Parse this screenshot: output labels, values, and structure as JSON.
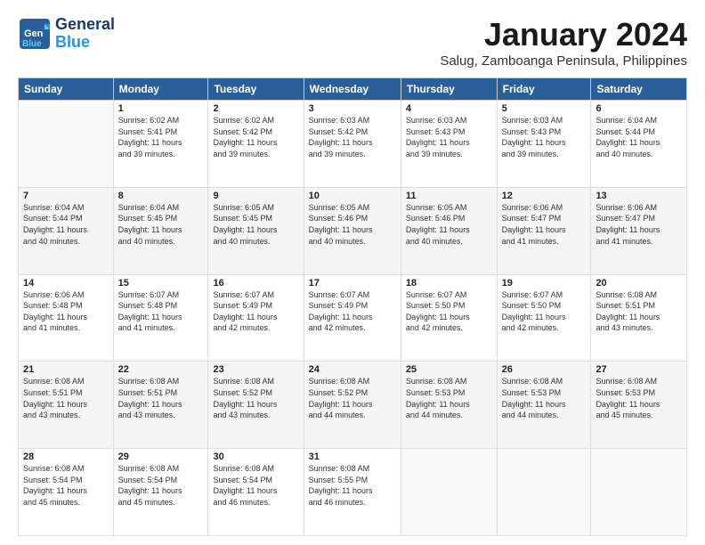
{
  "header": {
    "logo_line1": "General",
    "logo_line2": "Blue",
    "month": "January 2024",
    "location": "Salug, Zamboanga Peninsula, Philippines"
  },
  "weekdays": [
    "Sunday",
    "Monday",
    "Tuesday",
    "Wednesday",
    "Thursday",
    "Friday",
    "Saturday"
  ],
  "weeks": [
    [
      {
        "day": "",
        "lines": []
      },
      {
        "day": "1",
        "lines": [
          "Sunrise: 6:02 AM",
          "Sunset: 5:41 PM",
          "Daylight: 11 hours",
          "and 39 minutes."
        ]
      },
      {
        "day": "2",
        "lines": [
          "Sunrise: 6:02 AM",
          "Sunset: 5:42 PM",
          "Daylight: 11 hours",
          "and 39 minutes."
        ]
      },
      {
        "day": "3",
        "lines": [
          "Sunrise: 6:03 AM",
          "Sunset: 5:42 PM",
          "Daylight: 11 hours",
          "and 39 minutes."
        ]
      },
      {
        "day": "4",
        "lines": [
          "Sunrise: 6:03 AM",
          "Sunset: 5:43 PM",
          "Daylight: 11 hours",
          "and 39 minutes."
        ]
      },
      {
        "day": "5",
        "lines": [
          "Sunrise: 6:03 AM",
          "Sunset: 5:43 PM",
          "Daylight: 11 hours",
          "and 39 minutes."
        ]
      },
      {
        "day": "6",
        "lines": [
          "Sunrise: 6:04 AM",
          "Sunset: 5:44 PM",
          "Daylight: 11 hours",
          "and 40 minutes."
        ]
      }
    ],
    [
      {
        "day": "7",
        "lines": [
          "Sunrise: 6:04 AM",
          "Sunset: 5:44 PM",
          "Daylight: 11 hours",
          "and 40 minutes."
        ]
      },
      {
        "day": "8",
        "lines": [
          "Sunrise: 6:04 AM",
          "Sunset: 5:45 PM",
          "Daylight: 11 hours",
          "and 40 minutes."
        ]
      },
      {
        "day": "9",
        "lines": [
          "Sunrise: 6:05 AM",
          "Sunset: 5:45 PM",
          "Daylight: 11 hours",
          "and 40 minutes."
        ]
      },
      {
        "day": "10",
        "lines": [
          "Sunrise: 6:05 AM",
          "Sunset: 5:46 PM",
          "Daylight: 11 hours",
          "and 40 minutes."
        ]
      },
      {
        "day": "11",
        "lines": [
          "Sunrise: 6:05 AM",
          "Sunset: 5:46 PM",
          "Daylight: 11 hours",
          "and 40 minutes."
        ]
      },
      {
        "day": "12",
        "lines": [
          "Sunrise: 6:06 AM",
          "Sunset: 5:47 PM",
          "Daylight: 11 hours",
          "and 41 minutes."
        ]
      },
      {
        "day": "13",
        "lines": [
          "Sunrise: 6:06 AM",
          "Sunset: 5:47 PM",
          "Daylight: 11 hours",
          "and 41 minutes."
        ]
      }
    ],
    [
      {
        "day": "14",
        "lines": [
          "Sunrise: 6:06 AM",
          "Sunset: 5:48 PM",
          "Daylight: 11 hours",
          "and 41 minutes."
        ]
      },
      {
        "day": "15",
        "lines": [
          "Sunrise: 6:07 AM",
          "Sunset: 5:48 PM",
          "Daylight: 11 hours",
          "and 41 minutes."
        ]
      },
      {
        "day": "16",
        "lines": [
          "Sunrise: 6:07 AM",
          "Sunset: 5:49 PM",
          "Daylight: 11 hours",
          "and 42 minutes."
        ]
      },
      {
        "day": "17",
        "lines": [
          "Sunrise: 6:07 AM",
          "Sunset: 5:49 PM",
          "Daylight: 11 hours",
          "and 42 minutes."
        ]
      },
      {
        "day": "18",
        "lines": [
          "Sunrise: 6:07 AM",
          "Sunset: 5:50 PM",
          "Daylight: 11 hours",
          "and 42 minutes."
        ]
      },
      {
        "day": "19",
        "lines": [
          "Sunrise: 6:07 AM",
          "Sunset: 5:50 PM",
          "Daylight: 11 hours",
          "and 42 minutes."
        ]
      },
      {
        "day": "20",
        "lines": [
          "Sunrise: 6:08 AM",
          "Sunset: 5:51 PM",
          "Daylight: 11 hours",
          "and 43 minutes."
        ]
      }
    ],
    [
      {
        "day": "21",
        "lines": [
          "Sunrise: 6:08 AM",
          "Sunset: 5:51 PM",
          "Daylight: 11 hours",
          "and 43 minutes."
        ]
      },
      {
        "day": "22",
        "lines": [
          "Sunrise: 6:08 AM",
          "Sunset: 5:51 PM",
          "Daylight: 11 hours",
          "and 43 minutes."
        ]
      },
      {
        "day": "23",
        "lines": [
          "Sunrise: 6:08 AM",
          "Sunset: 5:52 PM",
          "Daylight: 11 hours",
          "and 43 minutes."
        ]
      },
      {
        "day": "24",
        "lines": [
          "Sunrise: 6:08 AM",
          "Sunset: 5:52 PM",
          "Daylight: 11 hours",
          "and 44 minutes."
        ]
      },
      {
        "day": "25",
        "lines": [
          "Sunrise: 6:08 AM",
          "Sunset: 5:53 PM",
          "Daylight: 11 hours",
          "and 44 minutes."
        ]
      },
      {
        "day": "26",
        "lines": [
          "Sunrise: 6:08 AM",
          "Sunset: 5:53 PM",
          "Daylight: 11 hours",
          "and 44 minutes."
        ]
      },
      {
        "day": "27",
        "lines": [
          "Sunrise: 6:08 AM",
          "Sunset: 5:53 PM",
          "Daylight: 11 hours",
          "and 45 minutes."
        ]
      }
    ],
    [
      {
        "day": "28",
        "lines": [
          "Sunrise: 6:08 AM",
          "Sunset: 5:54 PM",
          "Daylight: 11 hours",
          "and 45 minutes."
        ]
      },
      {
        "day": "29",
        "lines": [
          "Sunrise: 6:08 AM",
          "Sunset: 5:54 PM",
          "Daylight: 11 hours",
          "and 45 minutes."
        ]
      },
      {
        "day": "30",
        "lines": [
          "Sunrise: 6:08 AM",
          "Sunset: 5:54 PM",
          "Daylight: 11 hours",
          "and 46 minutes."
        ]
      },
      {
        "day": "31",
        "lines": [
          "Sunrise: 6:08 AM",
          "Sunset: 5:55 PM",
          "Daylight: 11 hours",
          "and 46 minutes."
        ]
      },
      {
        "day": "",
        "lines": []
      },
      {
        "day": "",
        "lines": []
      },
      {
        "day": "",
        "lines": []
      }
    ]
  ]
}
